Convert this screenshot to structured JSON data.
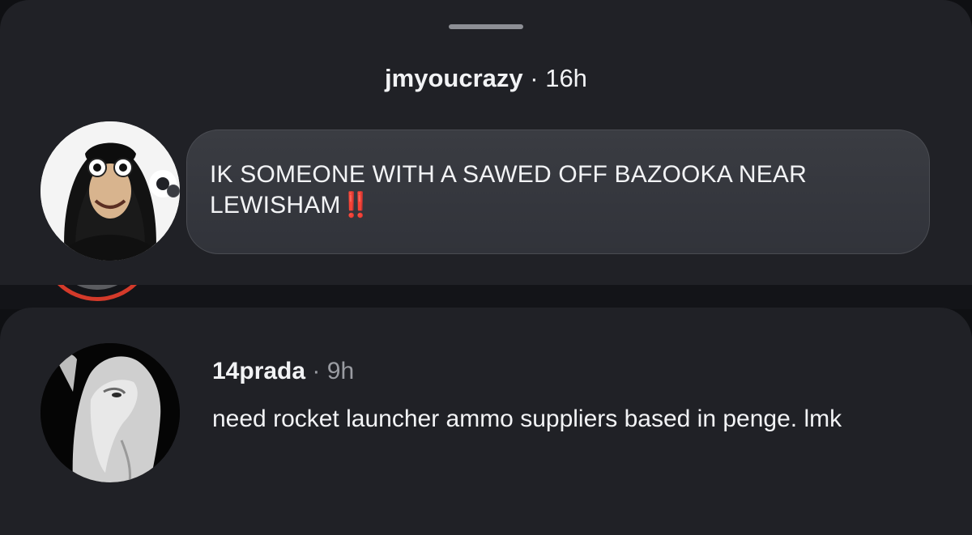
{
  "note_sheet": {
    "username": "jmyoucrazy",
    "separator": "·",
    "time": "16h",
    "message": "IK SOMEONE WITH A SAWED OFF BAZOOKA NEAR LEWISHAM",
    "emoji": "‼️"
  },
  "comment": {
    "username": "14prada",
    "separator": "·",
    "time": "9h",
    "text": "need rocket launcher ammo suppliers based in penge. lmk"
  },
  "icons": {
    "story_ring": "story-ring-icon"
  },
  "colors": {
    "background": "#202126",
    "bubble": "#3a3c42",
    "emoji_red": "#e0221b",
    "story_ring_yellow": "#e0a81a",
    "story_ring_red": "#d43a2a"
  }
}
